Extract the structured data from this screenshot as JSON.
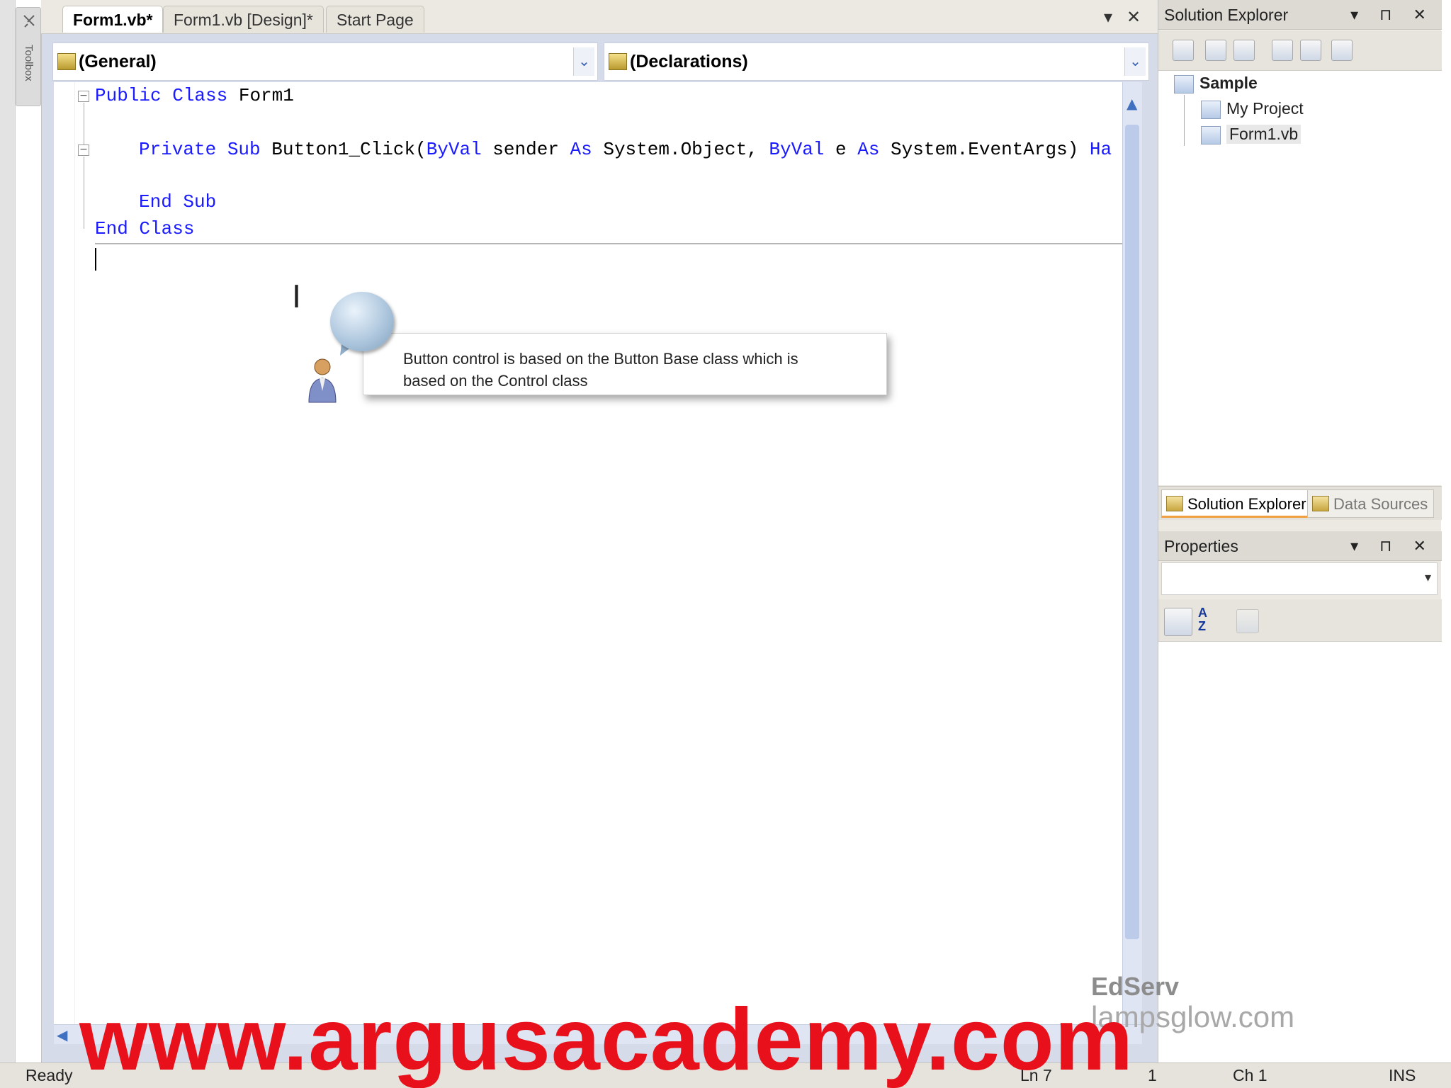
{
  "toolbox": {
    "label": "Toolbox"
  },
  "tabs": [
    {
      "label": "Form1.vb*",
      "active": true
    },
    {
      "label": "Form1.vb [Design]*",
      "active": false
    },
    {
      "label": "Start Page",
      "active": false
    }
  ],
  "tab_controls": {
    "dropdown": "▾",
    "close": "✕"
  },
  "combos": {
    "left": "(General)",
    "right": "(Declarations)"
  },
  "code": {
    "line1_kw": "Public Class",
    "line1_rest": " Form1",
    "line2_kw1": "Private Sub",
    "line2_mid1": " Button1_Click(",
    "line2_kw2": "ByVal",
    "line2_mid2": " sender ",
    "line2_kw3": "As",
    "line2_mid3": " System.Object, ",
    "line2_kw4": "ByVal",
    "line2_mid4": " e ",
    "line2_kw5": "As",
    "line2_mid5": " System.EventArgs) ",
    "line2_kw6": "Ha",
    "line3_kw": "End Sub",
    "line4_kw": "End Class"
  },
  "tooltip": {
    "line1": "Button control is based on the Button Base class which is",
    "line2": "based on the Control class"
  },
  "solution_explorer": {
    "title": "Solution Explorer",
    "controls": "▾ ⊓ ✕",
    "root": "Sample",
    "items": [
      "My Project",
      "Form1.vb"
    ],
    "tabs": [
      "Solution Explorer",
      "Data Sources"
    ]
  },
  "properties": {
    "title": "Properties",
    "controls": "▾ ⊓ ✕",
    "sort_alpha_label": "A Z"
  },
  "status": {
    "ready": "Ready",
    "ln": "Ln 7",
    "col": "1",
    "ch": "Ch 1",
    "ins": "INS"
  },
  "watermark": {
    "main": "www.argusacademy.com",
    "edserv": "EdServ",
    "lamp": "lampsglow.com"
  }
}
